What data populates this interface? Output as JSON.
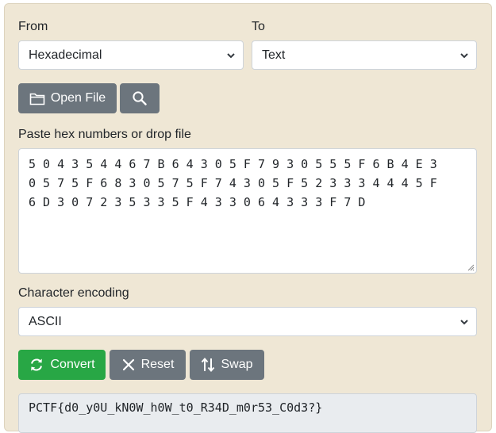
{
  "from": {
    "label": "From",
    "selected": "Hexadecimal"
  },
  "to": {
    "label": "To",
    "selected": "Text"
  },
  "toolbar": {
    "open_file_label": "Open File"
  },
  "input": {
    "label": "Paste hex numbers or drop file",
    "lines": [
      "5 0 4 3 5 4 4 6 7 B 6 4 3 0 5 F 7 9 3 0 5 5 5 F 6 B 4 E 3",
      "0 5 7 5 F 6 8 3 0 5 7 5 F 7 4 3 0 5 F 5 2 3 3 3 4 4 4 5 F",
      "6 D 3 0 7 2 3 5 3 3 5 F 4 3 3 0 6 4 3 3 3 F 7 D"
    ]
  },
  "encoding": {
    "label": "Character encoding",
    "selected": "ASCII"
  },
  "actions": {
    "convert_label": "Convert",
    "reset_label": "Reset",
    "swap_label": "Swap"
  },
  "output": {
    "text": "PCTF{d0_y0U_kN0W_h0W_t0_R34D_m0r53_C0d3?}"
  },
  "colors": {
    "panel": "#efe7d5",
    "gray_button": "#6c757d",
    "green_button": "#28a745"
  }
}
